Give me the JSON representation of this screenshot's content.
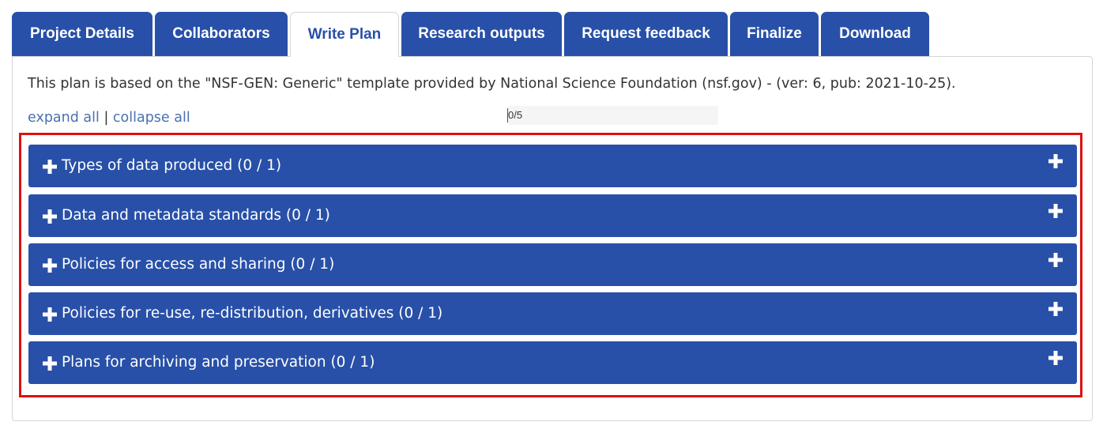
{
  "tabs": [
    {
      "label": "Project Details",
      "active": false
    },
    {
      "label": "Collaborators",
      "active": false
    },
    {
      "label": "Write Plan",
      "active": true
    },
    {
      "label": "Research outputs",
      "active": false
    },
    {
      "label": "Request feedback",
      "active": false
    },
    {
      "label": "Finalize",
      "active": false
    },
    {
      "label": "Download",
      "active": false
    }
  ],
  "template_info": "This plan is based on the \"NSF-GEN: Generic\" template provided by National Science Foundation (nsf.gov) - (ver: 6, pub: 2021-10-25).",
  "expand_all": "expand all",
  "separator": "|",
  "collapse_all": "collapse all",
  "progress": {
    "text": "0/5",
    "answered": 0,
    "total": 5
  },
  "sections": [
    {
      "title": "Types of data produced (0 / 1)"
    },
    {
      "title": "Data and metadata standards (0 / 1)"
    },
    {
      "title": "Policies for access and sharing (0 / 1)"
    },
    {
      "title": "Policies for re-use, re-distribution, derivatives (0 / 1)"
    },
    {
      "title": "Plans for archiving and preservation (0 / 1)"
    }
  ],
  "icons": {
    "section_left": "plus-icon",
    "section_right": "plus-icon"
  },
  "colors": {
    "primary": "#2850a8",
    "link": "#4a70b0",
    "highlight": "#e01010"
  }
}
